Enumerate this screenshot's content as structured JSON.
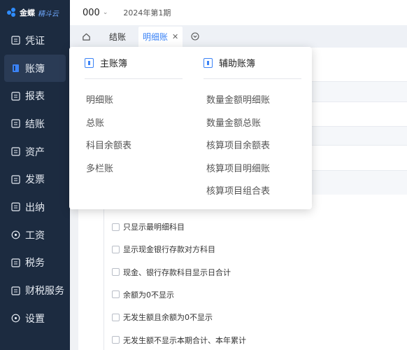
{
  "sidebar": {
    "logo": {
      "text": "金蝶",
      "sub": "精斗云"
    },
    "items": [
      {
        "label": "凭证",
        "icon": "voucher-icon",
        "active": false
      },
      {
        "label": "账簿",
        "icon": "ledger-book-icon",
        "active": true
      },
      {
        "label": "报表",
        "icon": "report-icon",
        "active": false
      },
      {
        "label": "结账",
        "icon": "checkout-icon",
        "active": false
      },
      {
        "label": "资产",
        "icon": "asset-icon",
        "active": false
      },
      {
        "label": "发票",
        "icon": "invoice-icon",
        "active": false
      },
      {
        "label": "出纳",
        "icon": "cashier-icon",
        "active": false
      },
      {
        "label": "工资",
        "icon": "salary-icon",
        "active": false
      },
      {
        "label": "税务",
        "icon": "tax-icon",
        "active": false
      },
      {
        "label": "财税服务",
        "icon": "finance-service-icon",
        "active": false
      },
      {
        "label": "设置",
        "icon": "settings-icon",
        "active": false
      }
    ]
  },
  "header": {
    "company": "000",
    "period": "2024年第1期"
  },
  "tabs": [
    {
      "label": "结账",
      "active": false
    },
    {
      "label": "明细账",
      "active": true
    }
  ],
  "dropdown": {
    "main": {
      "title": "主账簿",
      "items": [
        "明细账",
        "总账",
        "科目余额表",
        "多栏账"
      ]
    },
    "aux": {
      "title": "辅助账簿",
      "items": [
        "数量金额明细账",
        "数量金额总账",
        "核算项目余额表",
        "核算项目明细账",
        "核算项目组合表"
      ]
    }
  },
  "options": [
    "只显示最明细科目",
    "显示现金银行存款对方科目",
    "现金、银行存款科目显示日合计",
    "余额为0不显示",
    "无发生额且余额为0不显示",
    "无发生额不显示本期合计、本年累计"
  ],
  "colors": {
    "sidebar": "#1c2b40",
    "accent": "#3b83f6"
  }
}
